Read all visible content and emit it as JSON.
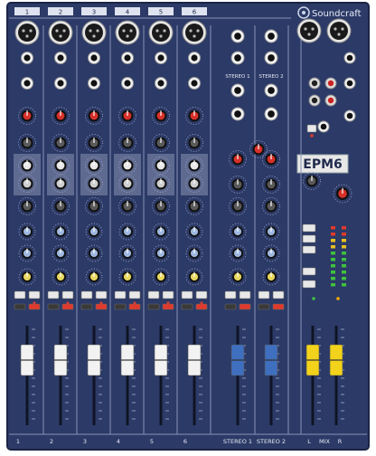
{
  "brand": {
    "name": "Soundcraft",
    "model_badge": "EPM6",
    "colors": {
      "panel": "#2c3a67",
      "panel_dark": "#1f2a4d",
      "strip_line": "#8892b6",
      "knob_red": "#d8302a",
      "knob_grey": "#dcdcdc",
      "knob_blue": "#9fb8e0",
      "knob_green": "#8cc48a",
      "knob_yellow": "#e8d860",
      "fader_white": "#f2f2f2",
      "fader_blue": "#3f6fbf",
      "fader_yellow": "#f2d21a",
      "led_red": "#e03a2c"
    }
  },
  "mono_channels": [
    {
      "number": "1",
      "bottom_label": "1"
    },
    {
      "number": "2",
      "bottom_label": "2"
    },
    {
      "number": "3",
      "bottom_label": "3"
    },
    {
      "number": "4",
      "bottom_label": "4"
    },
    {
      "number": "5",
      "bottom_label": "5"
    },
    {
      "number": "6",
      "bottom_label": "6"
    }
  ],
  "stereo_channels": [
    {
      "header": "STEREO 1",
      "bottom_label": "STEREO 1"
    },
    {
      "header": "STEREO 2",
      "bottom_label": "STEREO 2"
    }
  ],
  "master": {
    "bottom_left": "L",
    "bottom_mid": "MIX",
    "bottom_right": "R"
  }
}
